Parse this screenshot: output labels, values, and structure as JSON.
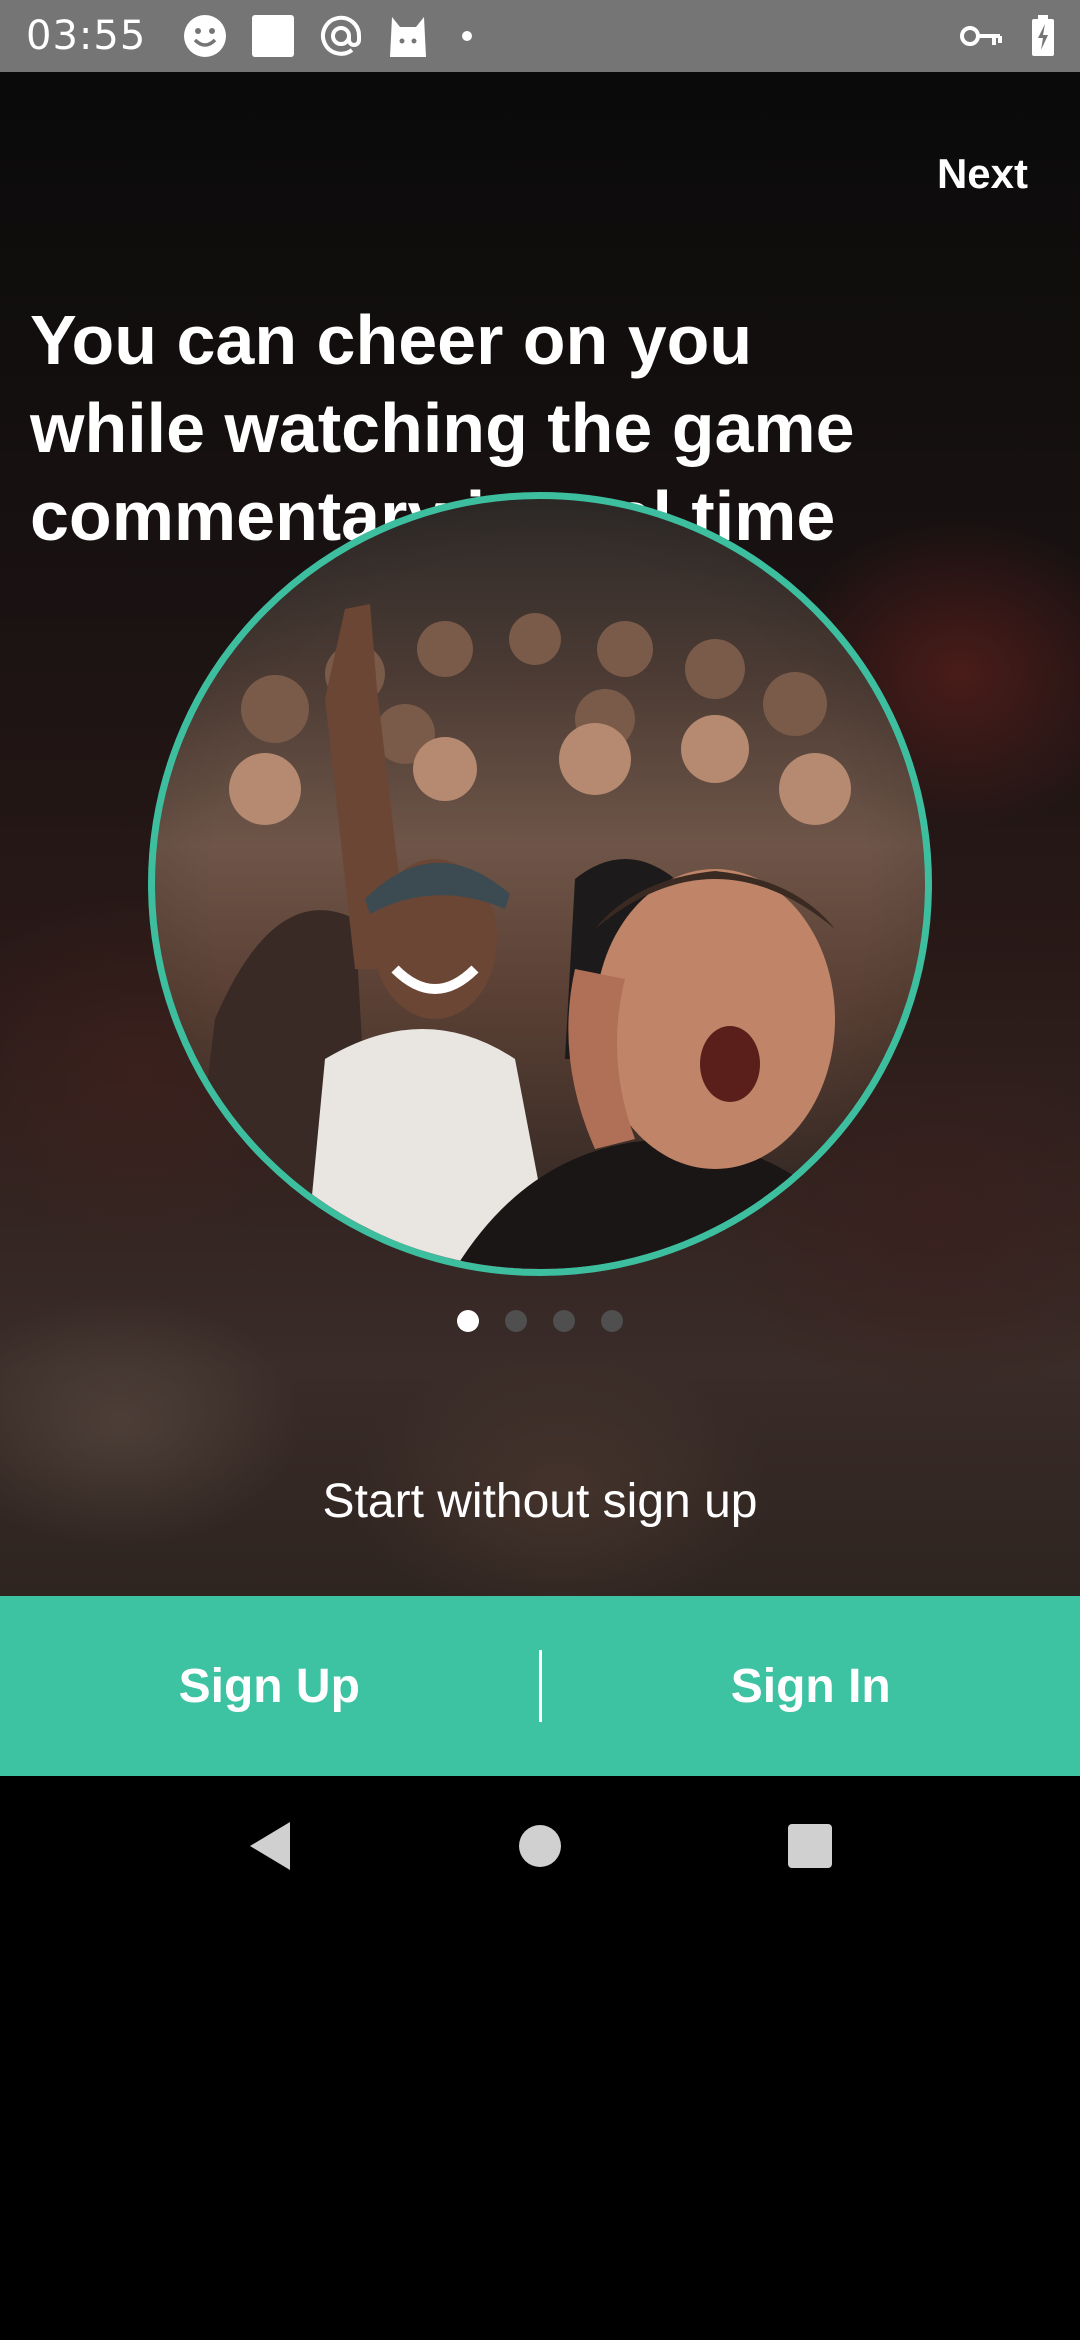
{
  "status_bar": {
    "time": "03:55",
    "left_icons": [
      "smiley-icon",
      "square-icon",
      "at-sign-icon",
      "cat-icon",
      "dot-icon"
    ],
    "right_icons": [
      "vpn-key-icon",
      "battery-charging-icon"
    ]
  },
  "onboarding": {
    "next_label": "Next",
    "headline_lines": [
      "You can cheer on you",
      "while watching the game",
      "commentary in real time"
    ],
    "page_indicator": {
      "total": 4,
      "active": 1
    },
    "start_without_signup": "Start without sign up"
  },
  "actions": {
    "sign_up_label": "Sign Up",
    "sign_in_label": "Sign In"
  },
  "colors": {
    "accent": "#3dc2a2",
    "status_bar": "#757575"
  },
  "nav_bar": {
    "buttons": [
      "back-icon",
      "home-icon",
      "recents-icon"
    ]
  }
}
